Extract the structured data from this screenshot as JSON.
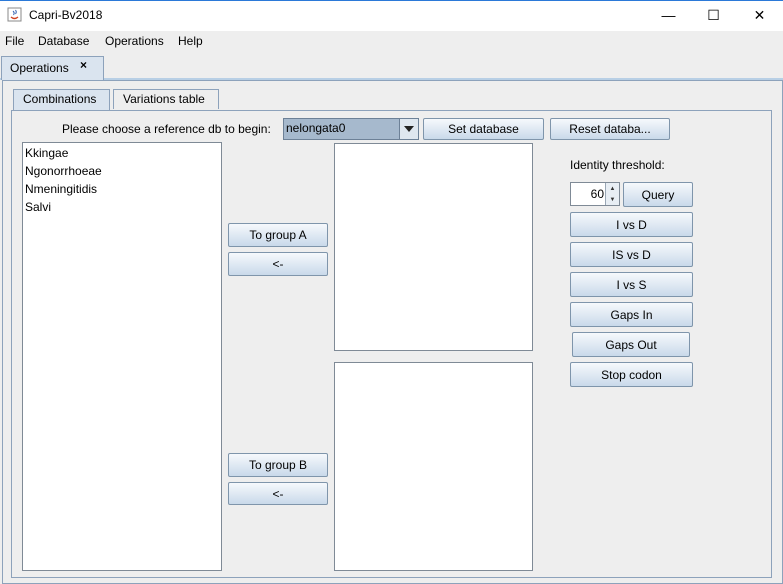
{
  "window": {
    "title": "Capri-Bv2018",
    "minimize": "—",
    "maximize": "☐",
    "close": "✕"
  },
  "menubar": [
    "File",
    "Database",
    "Operations",
    "Help"
  ],
  "outer_tab": {
    "label": "Operations",
    "close_glyph": "×"
  },
  "inner_tabs": [
    {
      "label": "Combinations",
      "selected": true
    },
    {
      "label": "Variations table",
      "selected": false
    }
  ],
  "reference": {
    "prompt": "Please choose a reference db to begin:",
    "selected": "nelongata0",
    "set_button": "Set database",
    "reset_button": "Reset databa..."
  },
  "species_list": [
    "Kkingae",
    "Ngonorrhoeae",
    "Nmeningitidis",
    "Salvi"
  ],
  "group_a": {
    "add_button": "To group A",
    "remove_button": "<-",
    "items": []
  },
  "group_b": {
    "add_button": "To group B",
    "remove_button": "<-",
    "items": []
  },
  "identity": {
    "label": "Identity threshold:",
    "value": "60",
    "query_button": "Query"
  },
  "action_buttons": [
    "I vs D",
    "IS vs D",
    "I vs S",
    "Gaps In",
    "Gaps Out",
    "Stop codon"
  ]
}
